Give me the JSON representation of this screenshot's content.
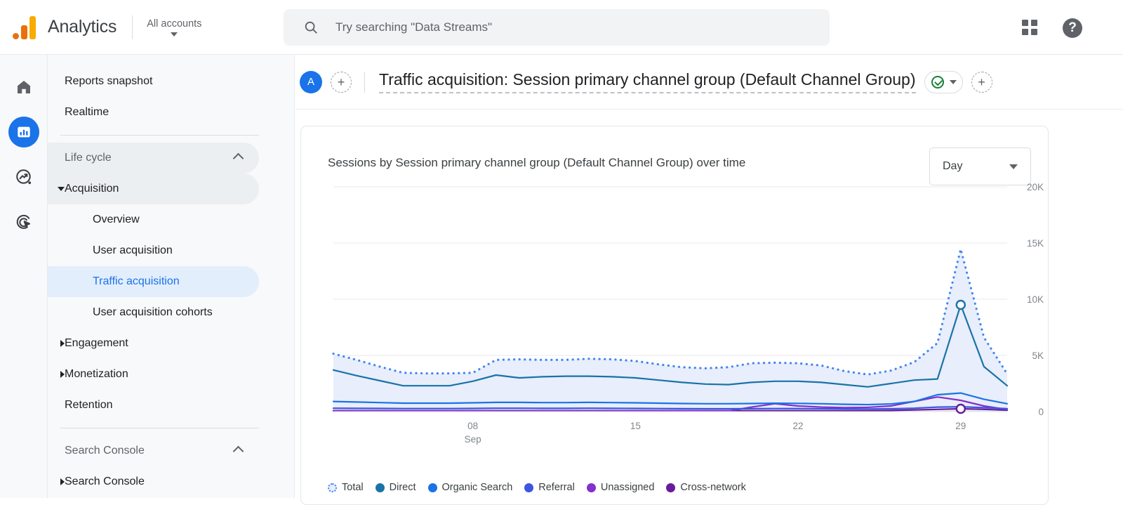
{
  "topbar": {
    "brand": "Analytics",
    "account_selector": "All accounts",
    "search_placeholder": "Try searching \"Data Streams\"",
    "apps_icon": "grid-apps-icon",
    "help_icon": "help-question-icon",
    "help_glyph": "?"
  },
  "rail": {
    "items": [
      {
        "icon": "home-icon",
        "active": false
      },
      {
        "icon": "reports-bar-chart-icon",
        "active": true
      },
      {
        "icon": "explore-trend-icon",
        "active": false
      },
      {
        "icon": "advertising-target-icon",
        "active": false
      }
    ]
  },
  "sidebar": {
    "items": [
      {
        "label": "Reports snapshot",
        "level": 1,
        "state": "normal"
      },
      {
        "label": "Realtime",
        "level": 1,
        "state": "normal"
      },
      {
        "label": "Life cycle",
        "level": 1,
        "state": "group-open",
        "chevron": "chevron-up-icon"
      },
      {
        "label": "Acquisition",
        "level": 1,
        "state": "selected-grey",
        "caret": "caret-down-icon"
      },
      {
        "label": "Overview",
        "level": 2,
        "state": "normal"
      },
      {
        "label": "User acquisition",
        "level": 2,
        "state": "normal"
      },
      {
        "label": "Traffic acquisition",
        "level": 2,
        "state": "selected-blue"
      },
      {
        "label": "User acquisition cohorts",
        "level": 2,
        "state": "normal"
      },
      {
        "label": "Engagement",
        "level": 1,
        "state": "normal",
        "caret": "caret-right-icon"
      },
      {
        "label": "Monetization",
        "level": 1,
        "state": "normal",
        "caret": "caret-right-icon"
      },
      {
        "label": "Retention",
        "level": 1,
        "state": "normal"
      },
      {
        "label": "Search Console",
        "level": 1,
        "state": "group",
        "chevron": "chevron-up-icon"
      },
      {
        "label": "Search Console",
        "level": 1,
        "state": "normal",
        "caret": "caret-right-icon"
      }
    ]
  },
  "header": {
    "avatar_initial": "A",
    "add_comparison_glyph": "+",
    "title": "Traffic acquisition: Session primary channel group (Default Channel Group)",
    "status_icon": "check-circle-icon",
    "add_right_glyph": "+"
  },
  "card": {
    "title": "Sessions by Session primary channel group (Default Channel Group) over time",
    "granularity_value": "Day",
    "granularity_caret": "chevron-down-icon"
  },
  "colors": {
    "accent_blue": "#1a73e8",
    "total": "#4285f4",
    "direct": "#1a73a8",
    "organic_search": "#1a73e8",
    "referral": "#3d56e0",
    "unassigned": "#8430ce",
    "cross_network": "#6a1b9a",
    "area_fill": "#e8eefb",
    "logo_orange": "#e8710a",
    "logo_yellow": "#f9ab00",
    "status_green": "#188038"
  },
  "chart_data": {
    "type": "line",
    "title": "Sessions by Session primary channel group (Default Channel Group) over time",
    "xlabel": "",
    "ylabel": "",
    "ylim": [
      0,
      20000
    ],
    "yticks": [
      0,
      5000,
      10000,
      15000,
      20000
    ],
    "ytick_labels": [
      "0",
      "5K",
      "10K",
      "15K",
      "20K"
    ],
    "grid": true,
    "legend_position": "bottom-left",
    "x": [
      "02",
      "03",
      "04",
      "05",
      "06",
      "07",
      "08",
      "09",
      "10",
      "11",
      "12",
      "13",
      "14",
      "15",
      "16",
      "17",
      "18",
      "19",
      "20",
      "21",
      "22",
      "23",
      "24",
      "25",
      "26",
      "27",
      "28",
      "29",
      "30",
      "01"
    ],
    "xtick_labels": [
      {
        "value": "08",
        "sub": "Sep"
      },
      {
        "value": "15",
        "sub": ""
      },
      {
        "value": "22",
        "sub": ""
      },
      {
        "value": "29",
        "sub": ""
      }
    ],
    "series": [
      {
        "name": "Total",
        "color": "#4285f4",
        "style": "dotted",
        "filled": true,
        "values": [
          5150,
          4600,
          4000,
          3450,
          3400,
          3400,
          3450,
          4600,
          4650,
          4600,
          4600,
          4700,
          4650,
          4500,
          4200,
          3950,
          3850,
          3950,
          4300,
          4350,
          4300,
          4100,
          3600,
          3300,
          3650,
          4400,
          6100,
          14450,
          6600,
          3350
        ]
      },
      {
        "name": "Direct",
        "color": "#1a73a8",
        "style": "solid",
        "values": [
          3700,
          3200,
          2750,
          2300,
          2300,
          2300,
          2700,
          3250,
          3000,
          3100,
          3150,
          3150,
          3100,
          3000,
          2800,
          2600,
          2450,
          2400,
          2600,
          2700,
          2700,
          2600,
          2400,
          2200,
          2500,
          2800,
          2900,
          9500,
          4000,
          2300
        ]
      },
      {
        "name": "Organic Search",
        "color": "#1a73e8",
        "style": "solid",
        "values": [
          900,
          850,
          800,
          750,
          750,
          750,
          780,
          820,
          820,
          800,
          800,
          820,
          800,
          780,
          750,
          720,
          700,
          700,
          720,
          740,
          730,
          700,
          650,
          620,
          680,
          900,
          1500,
          1650,
          1100,
          700
        ]
      },
      {
        "name": "Referral",
        "color": "#3d56e0",
        "style": "solid",
        "values": [
          300,
          290,
          280,
          270,
          270,
          270,
          280,
          300,
          300,
          290,
          290,
          300,
          290,
          280,
          270,
          260,
          250,
          250,
          260,
          270,
          265,
          255,
          240,
          230,
          250,
          300,
          400,
          430,
          350,
          260
        ]
      },
      {
        "name": "Unassigned",
        "color": "#8430ce",
        "style": "solid",
        "values": [
          60,
          60,
          60,
          60,
          60,
          60,
          60,
          60,
          60,
          60,
          60,
          60,
          60,
          60,
          60,
          60,
          60,
          60,
          400,
          700,
          500,
          400,
          350,
          380,
          500,
          900,
          1300,
          1000,
          500,
          180
        ]
      },
      {
        "name": "Cross-network",
        "color": "#6a1b9a",
        "style": "solid",
        "values": [
          80,
          80,
          80,
          80,
          80,
          80,
          80,
          80,
          80,
          80,
          80,
          80,
          80,
          80,
          80,
          80,
          80,
          80,
          80,
          80,
          80,
          80,
          80,
          80,
          100,
          150,
          200,
          250,
          200,
          120
        ]
      }
    ],
    "markers": [
      {
        "series": "Direct",
        "x_index": 27,
        "value": 9500
      },
      {
        "series": "Cross-network",
        "x_index": 27,
        "value": 250
      }
    ]
  }
}
